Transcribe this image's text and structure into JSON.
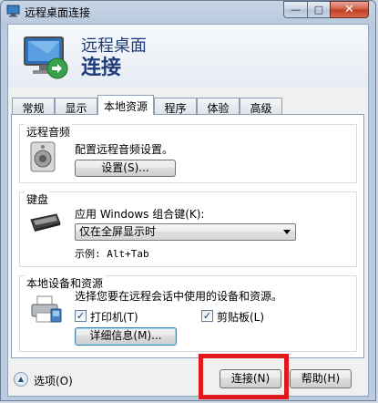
{
  "window": {
    "title": "远程桌面连接",
    "min_glyph": "—",
    "max_glyph": "□",
    "close_glyph": "✕"
  },
  "header": {
    "line1": "远程桌面",
    "line2": "连接"
  },
  "tabs": [
    {
      "label": "常规",
      "active": false
    },
    {
      "label": "显示",
      "active": false
    },
    {
      "label": "本地资源",
      "active": true
    },
    {
      "label": "程序",
      "active": false
    },
    {
      "label": "体验",
      "active": false
    },
    {
      "label": "高级",
      "active": false
    }
  ],
  "audio": {
    "title": "远程音频",
    "description": "配置远程音频设置。",
    "settings_button": "设置(S)..."
  },
  "keyboard": {
    "title": "键盘",
    "label": "应用 Windows 组合键(K):",
    "selected": "仅在全屏显示时",
    "example": "示例: Alt+Tab"
  },
  "devices": {
    "title": "本地设备和资源",
    "description": "选择您要在远程会话中使用的设备和资源。",
    "printer_label": "打印机(T)",
    "printer_checked": true,
    "clipboard_label": "剪贴板(L)",
    "clipboard_checked": true,
    "details_button": "详细信息(M)..."
  },
  "footer": {
    "options_label": "选项(O)",
    "connect_button": "连接(N)",
    "help_button": "帮助(H)"
  },
  "colors": {
    "highlight_box": "#e2191c",
    "header_text": "#1f3d7a"
  }
}
